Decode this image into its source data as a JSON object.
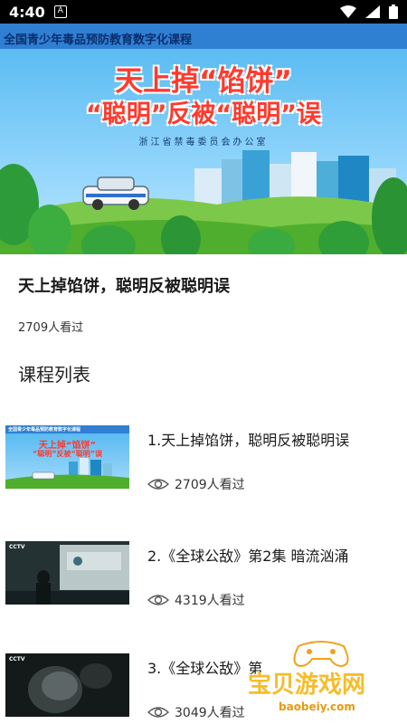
{
  "status_bar": {
    "time": "4:40",
    "sim_label": "A"
  },
  "banner": {
    "header": "全国青少年毒品预防教育数字化课程",
    "title_line1": "天上掉“馅饼”",
    "title_line2": "“聪明”反被“聪明”误",
    "issuer": "浙江省禁毒委员会办公室"
  },
  "video": {
    "title": "天上掉馅饼，聪明反被聪明误",
    "views": "2709人看过"
  },
  "section": {
    "title": "课程列表"
  },
  "courses": [
    {
      "title": "1.天上掉馅饼，聪明反被聪明误",
      "views": "2709人看过",
      "thumb": {
        "header": "全国青少年毒品预防教育数字化课程",
        "line1": "天上掉“馅饼”",
        "line2": "“聪明”反被“聪明”误"
      }
    },
    {
      "title": "2.《全球公敌》第2集 暗流汹涌",
      "views": "4319人看过",
      "thumb": {
        "logo": "CCTV"
      }
    },
    {
      "title": "3.《全球公敌》第",
      "views": "3049人看过",
      "thumb": {
        "logo": "CCTV"
      }
    }
  ],
  "watermark": {
    "text": "宝贝游戏网",
    "url": "baobeiy.com"
  }
}
